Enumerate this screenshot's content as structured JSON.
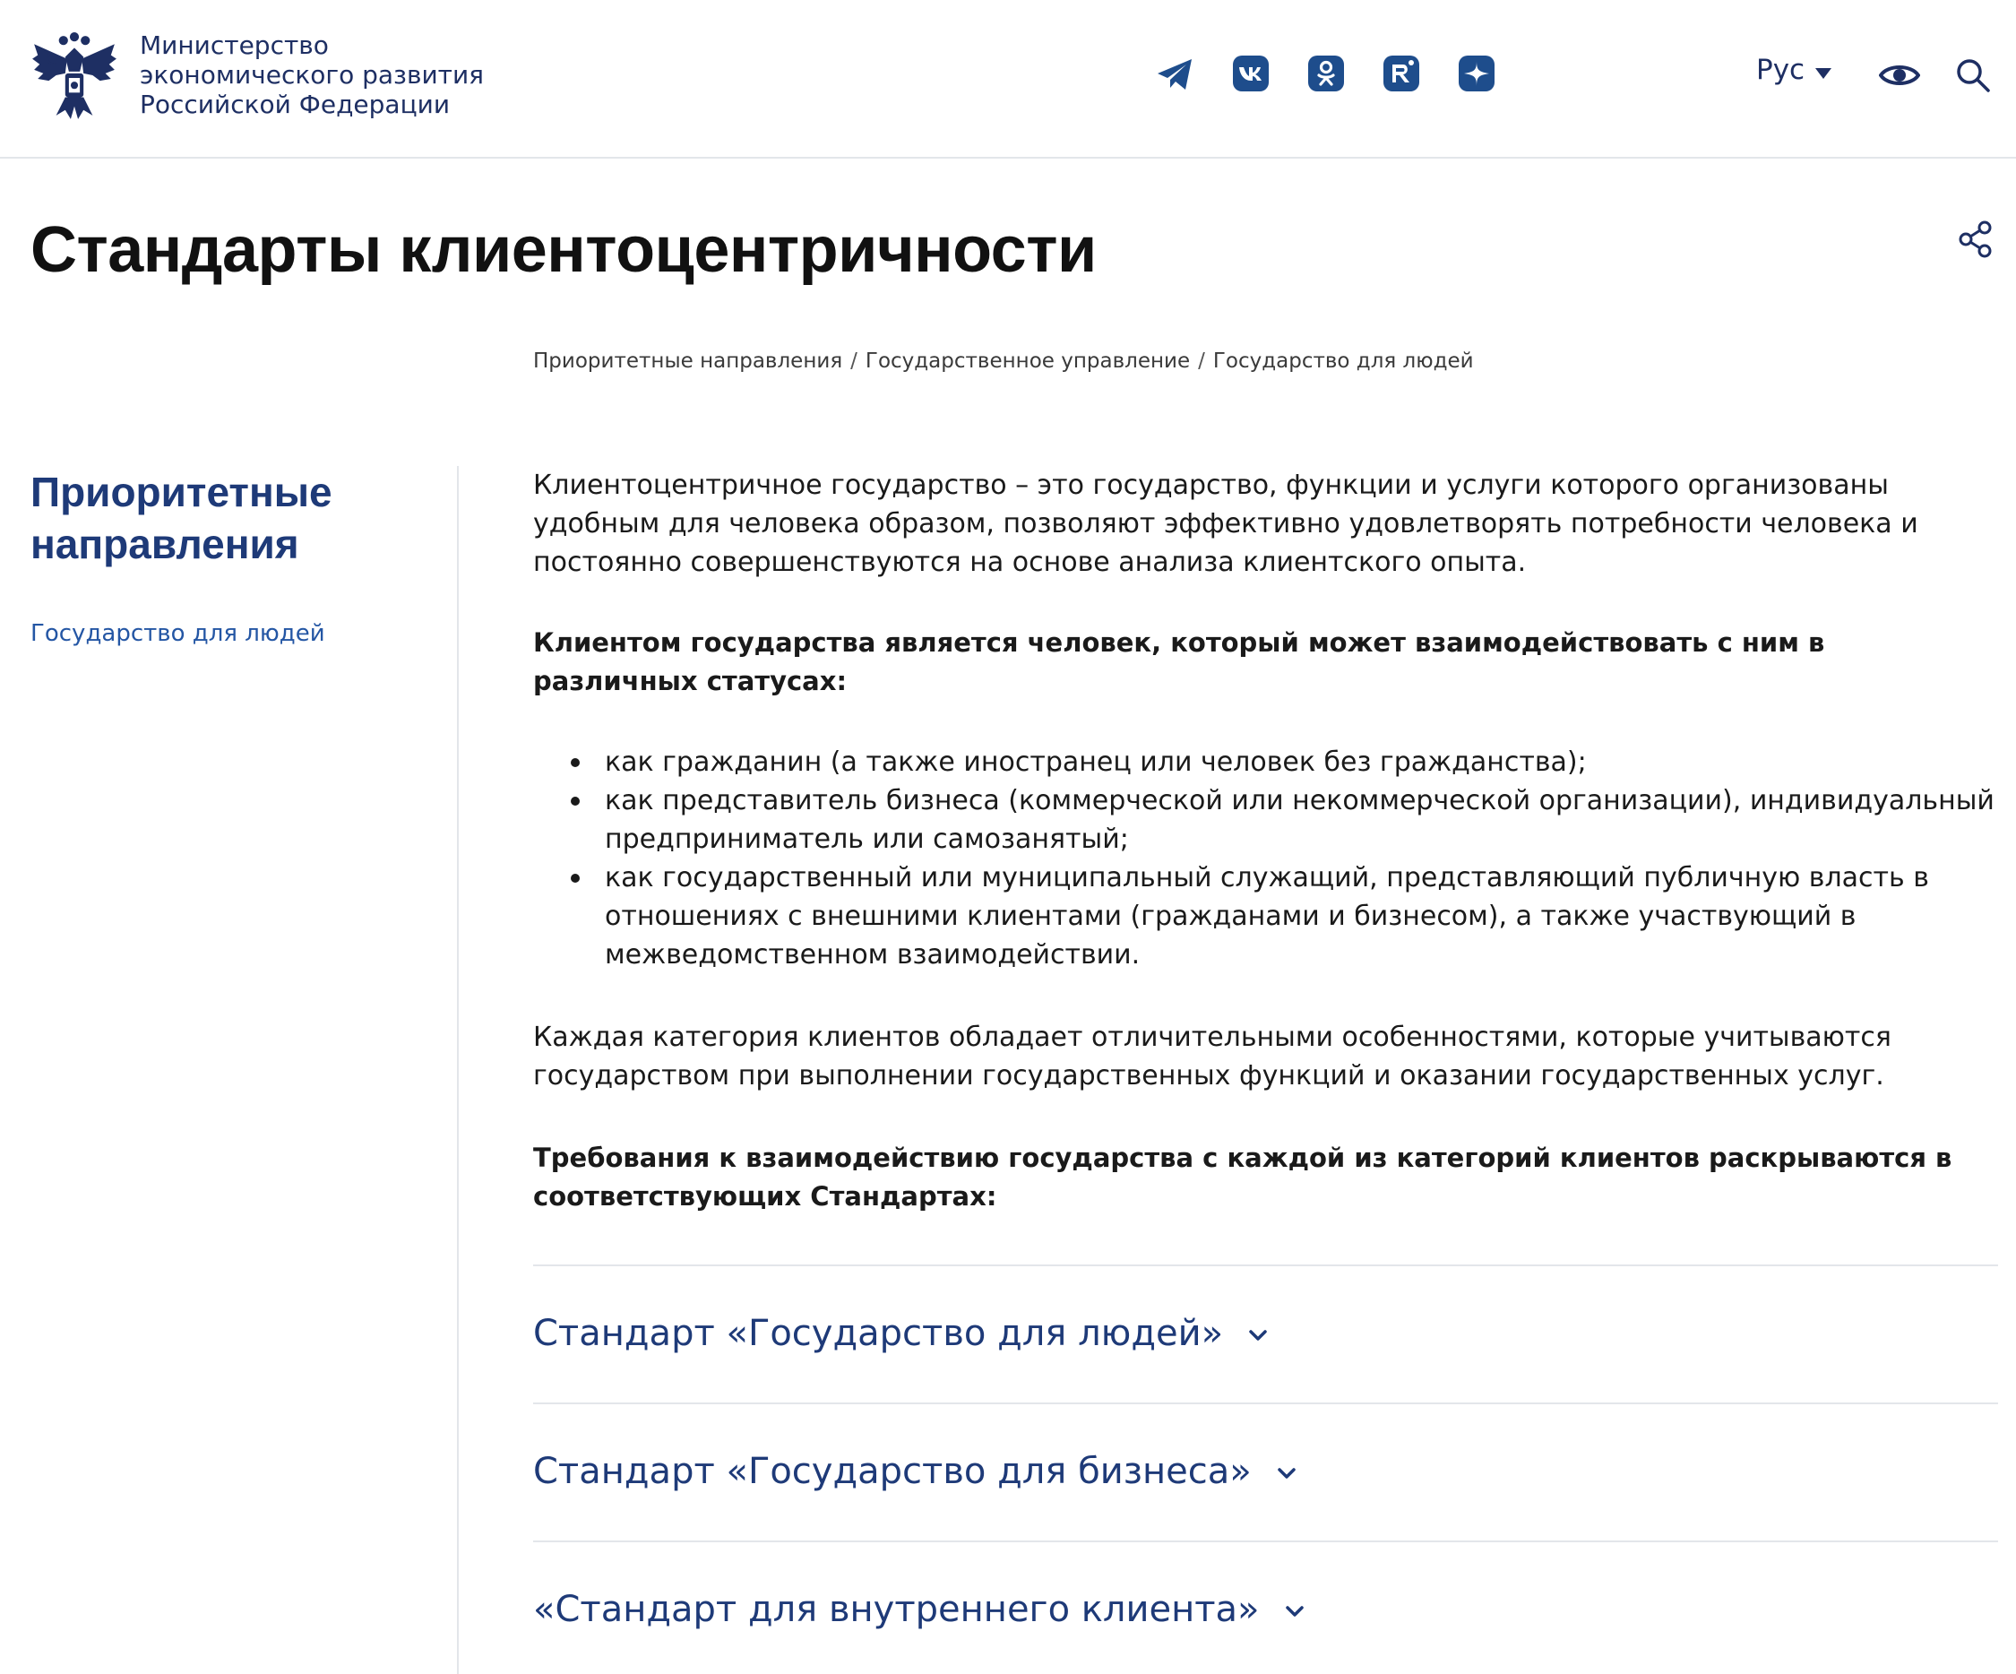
{
  "header": {
    "org_name": [
      "Министерство",
      "экономического развития",
      "Российской Федерации"
    ],
    "socials": [
      "telegram-icon",
      "vk-icon",
      "odnoklassniki-icon",
      "rutube-icon",
      "dzen-icon"
    ],
    "language": "Рус"
  },
  "page": {
    "title": "Стандарты клиентоцентричности"
  },
  "breadcrumb": [
    "Приоритетные направления",
    "Государственное управление",
    "Государство для людей"
  ],
  "sidebar": {
    "title": "Приоритетные направления",
    "link": "Государство для людей"
  },
  "content": {
    "intro": "Клиентоцентричное государство – это государство, функции и услуги которого организованы удобным для человека образом, позволяют эффективно удовлетворять потребности человека и постоянно совершенствуются на основе анализа клиентского опыта.",
    "client_heading": "Клиентом государства является человек, который может взаимодействовать с ним в различных статусах:",
    "bullets": [
      "как гражданин (а также иностранец или человек без гражданства);",
      "как представитель бизнеса (коммерческой или некоммерческой организации), индивидуальный предприниматель или самозанятый;",
      "как государственный или муниципальный служащий, представляющий публичную власть в отношениях с внешними клиентами (гражданами и бизнесом), а также участвующий в межведомственном взаимодействии."
    ],
    "categories_text": "Каждая категория клиентов обладает отличительными особенностями, которые учитываются государством при выполнении государственных функций и оказании государственных услуг.",
    "requirements_heading": "Требования к взаимодействию государства с каждой из категорий клиентов раскрываются в соответствующих Стандартах:"
  },
  "accordion": [
    "Стандарт «Государство для людей»",
    "Стандарт «Государство для бизнеса»",
    "«Стандарт для внутреннего клиента»"
  ],
  "colors": {
    "brand_blue": "#1e2f63",
    "link_blue": "#2456a4",
    "heading_blue": "#1e3a78",
    "divider": "#e3e6ea"
  }
}
